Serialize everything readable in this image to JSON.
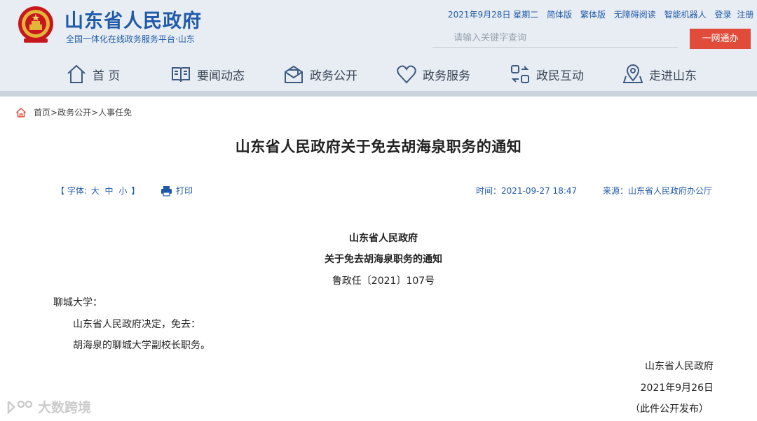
{
  "site": {
    "title": "山东省人民政府",
    "subtitle": "全国一体化在线政务服务平台·山东"
  },
  "top_links": {
    "date": "2021年9月28日 星期二",
    "simplified": "简体版",
    "traditional": "繁体版",
    "accessible": "无障碍阅读",
    "robot": "智能机器人",
    "login": "登录",
    "register": "注册"
  },
  "search": {
    "placeholder": "请输入关键字查询"
  },
  "one_net_button": "一网通办",
  "nav": [
    {
      "label": "首 页",
      "icon": "home-icon"
    },
    {
      "label": "要闻动态",
      "icon": "book-icon"
    },
    {
      "label": "政务公开",
      "icon": "mail-icon"
    },
    {
      "label": "政务服务",
      "icon": "heart-icon"
    },
    {
      "label": "政民互动",
      "icon": "interaction-icon"
    },
    {
      "label": "走进山东",
      "icon": "map-pin-icon"
    }
  ],
  "breadcrumb": {
    "home": "首页",
    "sep1": ">",
    "level1": "政务公开",
    "sep2": ">",
    "level2": "人事任免"
  },
  "article": {
    "title": "山东省人民政府关于免去胡海泉职务的通知",
    "font_label": "【 字体: ",
    "font_large": "大",
    "font_medium": "中",
    "font_small": "小",
    "font_close": " 】",
    "print_label": "打印",
    "time": "时间：2021-09-27 18:47",
    "source": "来源：山东省人民政府办公厅"
  },
  "document": {
    "issuer": "山东省人民政府",
    "heading": "关于免去胡海泉职务的通知",
    "doc_number": "鲁政任〔2021〕107号",
    "addressee": "聊城大学：",
    "body_1": "山东省人民政府决定，免去：",
    "body_2": "胡海泉的聊城大学副校长职务。",
    "signature": "山东省人民政府",
    "date": "2021年9月26日",
    "note": "（此件公开发布）"
  },
  "watermark": {
    "text": "大数跨境"
  },
  "colors": {
    "brand_blue": "#1f5aa8",
    "header_bg": "#e8edf4",
    "button_red": "#e04b3a"
  }
}
